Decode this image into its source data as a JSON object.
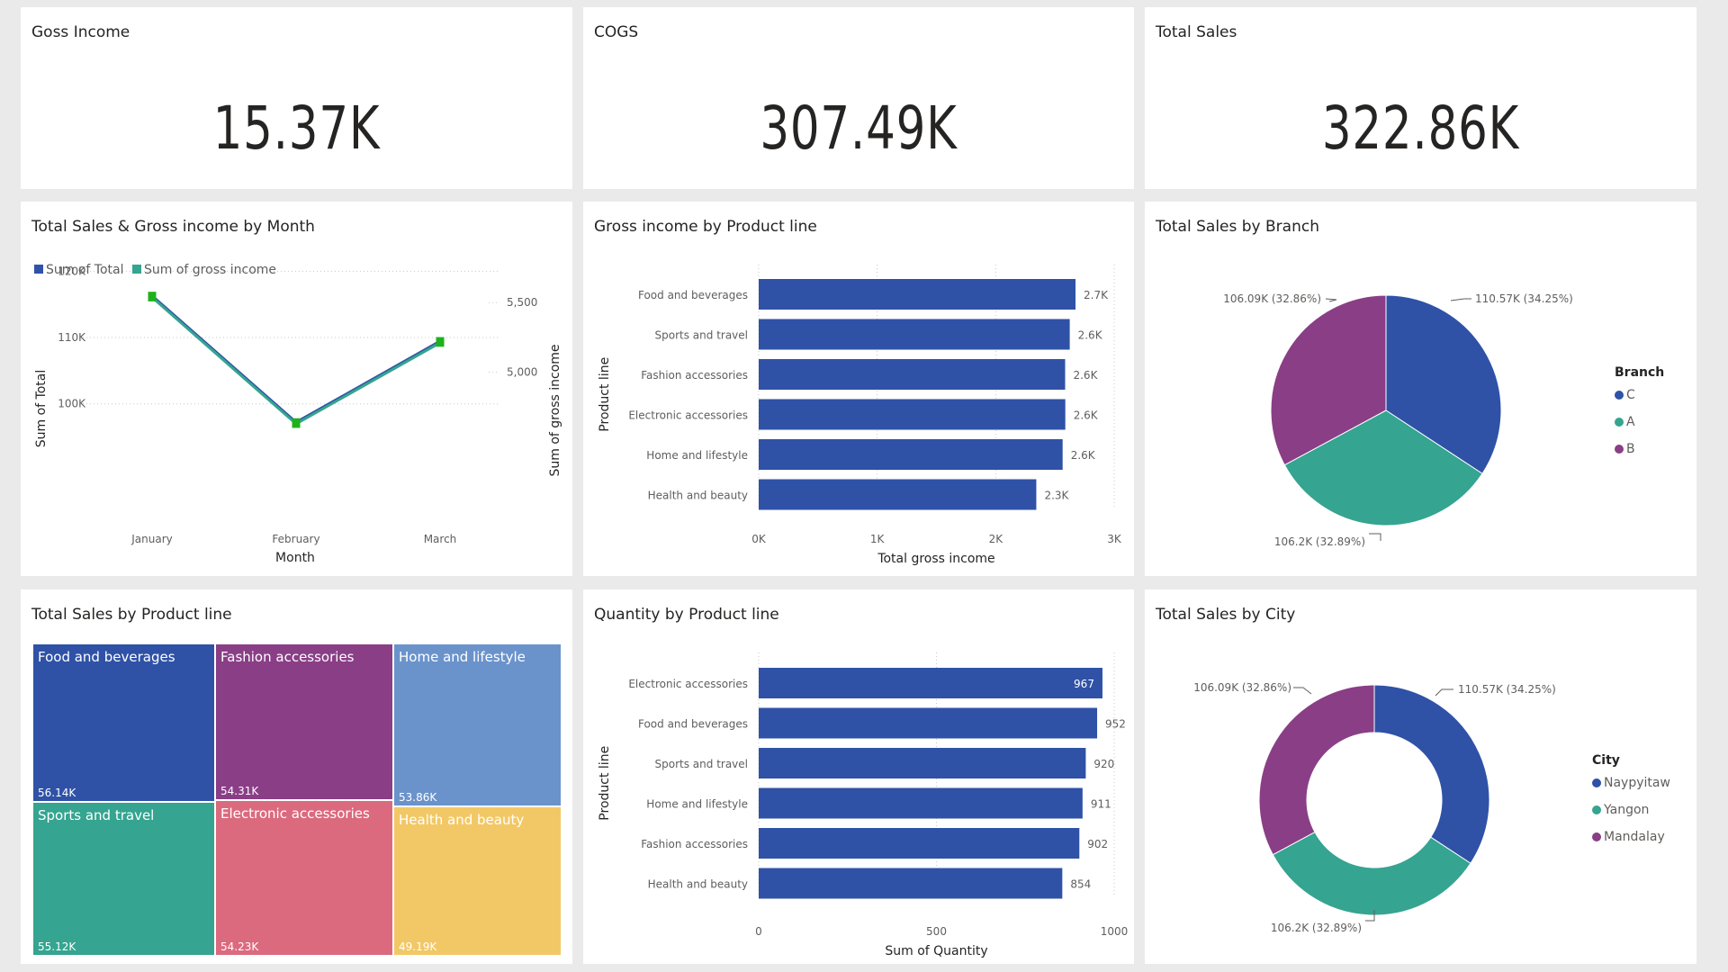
{
  "kpis": {
    "gross_income": {
      "title": "Goss Income",
      "value": "15.37K"
    },
    "cogs": {
      "title": "COGS",
      "value": "307.49K"
    },
    "total_sales": {
      "title": "Total Sales",
      "value": "322.86K"
    }
  },
  "colors": {
    "blue": "#2F52A7",
    "teal": "#35A490",
    "purple": "#8A3E86",
    "green_marker": "#1DB21D",
    "light_blue": "#6B93CB",
    "pink": "#DB6A7E",
    "yellow": "#F2C866"
  },
  "chart_data": [
    {
      "id": "sales_gross_month",
      "type": "line",
      "title": "Total Sales & Gross income by Month",
      "xlabel": "Month",
      "ylabel": "Sum of Total",
      "y2label": "Sum of gross income",
      "categories": [
        "January",
        "February",
        "March"
      ],
      "series": [
        {
          "name": "Sum of Total",
          "axis": "left",
          "values": [
            116290,
            97219,
            109456
          ]
        },
        {
          "name": "Sum of gross income",
          "axis": "right",
          "values": [
            5537.7,
            4629.5,
            5212.2
          ]
        }
      ],
      "y_ticks": [
        "120K",
        "110K",
        "100K"
      ],
      "y2_ticks": [
        "5,500",
        "5,000"
      ],
      "ylim": [
        92500,
        121000
      ],
      "y2lim": [
        4416,
        5773
      ],
      "legend": "top-left"
    },
    {
      "id": "gross_income_product",
      "type": "bar",
      "orientation": "horizontal",
      "title": "Gross income by Product line",
      "xlabel": "Total gross income",
      "ylabel": "Product line",
      "categories": [
        "Food and beverages",
        "Sports and travel",
        "Fashion accessories",
        "Electronic accessories",
        "Home and lifestyle",
        "Health and beauty"
      ],
      "values": [
        2673.56,
        2624.9,
        2586.0,
        2587.5,
        2564.9,
        2342.6
      ],
      "data_labels": [
        "2.7K",
        "2.6K",
        "2.6K",
        "2.6K",
        "2.6K",
        "2.3K"
      ],
      "x_ticks": [
        "0K",
        "1K",
        "2K",
        "3K"
      ],
      "xlim": [
        0,
        3000
      ]
    },
    {
      "id": "sales_branch",
      "type": "pie",
      "title": "Total Sales by Branch",
      "legend_title": "Branch",
      "labels": [
        "C",
        "A",
        "B"
      ],
      "values": [
        110.57,
        106.2,
        106.09
      ],
      "data_labels": [
        "110.57K (34.25%)",
        "106.2K (32.89%)",
        "106.09K (32.86%)"
      ],
      "legend": "right"
    },
    {
      "id": "sales_product_treemap",
      "type": "treemap",
      "title": "Total Sales by Product line",
      "labels": [
        "Food and beverages",
        "Sports and travel",
        "Fashion accessories",
        "Electronic accessories",
        "Home and lifestyle",
        "Health and beauty"
      ],
      "values": [
        56.14,
        55.12,
        54.31,
        54.23,
        53.86,
        49.19
      ],
      "data_labels": [
        "56.14K",
        "55.12K",
        "54.31K",
        "54.23K",
        "53.86K",
        "49.19K"
      ]
    },
    {
      "id": "quantity_product",
      "type": "bar",
      "orientation": "horizontal",
      "title": "Quantity by Product line",
      "xlabel": "Sum of Quantity",
      "ylabel": "Product line",
      "categories": [
        "Electronic accessories",
        "Food and beverages",
        "Sports and travel",
        "Home and lifestyle",
        "Fashion accessories",
        "Health and beauty"
      ],
      "values": [
        967,
        952,
        920,
        911,
        902,
        854
      ],
      "data_labels": [
        "967",
        "952",
        "920",
        "911",
        "902",
        "854"
      ],
      "x_ticks": [
        "0",
        "500",
        "1000"
      ],
      "xlim": [
        0,
        1000
      ]
    },
    {
      "id": "sales_city",
      "type": "donut",
      "title": "Total Sales by City",
      "legend_title": "City",
      "labels": [
        "Naypyitaw",
        "Yangon",
        "Mandalay"
      ],
      "values": [
        110.57,
        106.2,
        106.09
      ],
      "data_labels": [
        "110.57K (34.25%)",
        "106.2K (32.89%)",
        "106.09K (32.86%)"
      ],
      "legend": "right"
    }
  ]
}
